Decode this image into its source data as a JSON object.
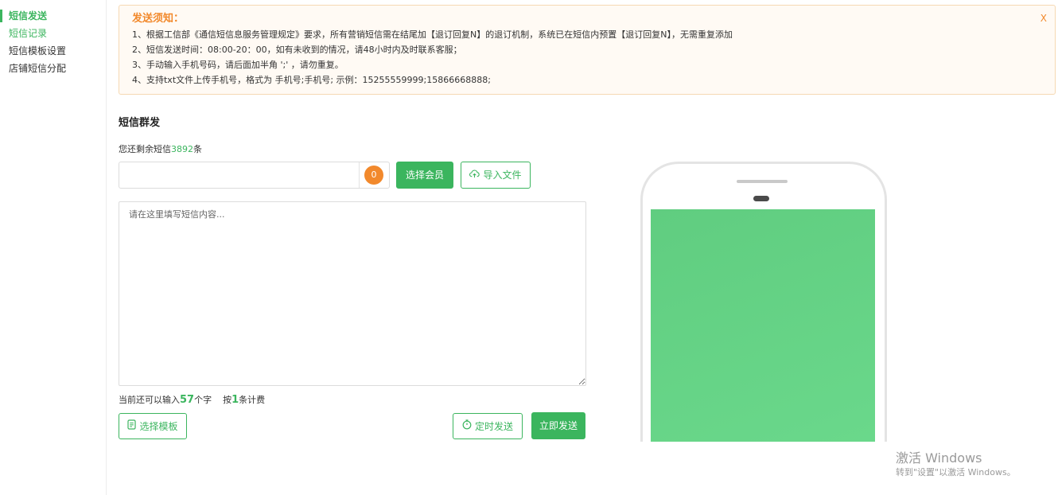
{
  "sidebar": {
    "items": [
      {
        "label": "短信发送"
      },
      {
        "label": "短信记录"
      },
      {
        "label": "短信模板设置"
      },
      {
        "label": "店铺短信分配"
      }
    ]
  },
  "notice": {
    "title": "发送须知：",
    "close": "X",
    "lines": [
      "1、根据工信部《通信短信息服务管理规定》要求，所有营销短信需在结尾加【退订回复N】的退订机制，系统已在短信内预置【退订回复N】，无需重复添加",
      "2、短信发送时间：08:00-20：00，如有未收到的情况，请48小时内及时联系客服；",
      "3、手动输入手机号码，请后面加半角 ';' ，请勿重复。",
      "4、支持txt文件上传手机号，格式为 手机号;手机号; 示例：15255559999;15866668888;"
    ]
  },
  "section_title": "短信群发",
  "remain": {
    "prefix": "您还剩余短信",
    "count": "3892",
    "suffix": "条"
  },
  "phone_input": {
    "value": "",
    "count": "0"
  },
  "buttons": {
    "select_member": "选择会员",
    "import_file": "导入文件",
    "select_template": "选择模板",
    "scheduled_send": "定时发送",
    "send_now": "立即发送"
  },
  "content": {
    "placeholder": "请在这里填写短信内容..."
  },
  "char_info": {
    "prefix": "当前还可以输入",
    "chars": "57",
    "mid": "个字",
    "bill_prefix": "按",
    "bill_count": "1",
    "bill_suffix": "条计费"
  },
  "watermark": {
    "line1": "激活 Windows",
    "line2": "转到\"设置\"以激活 Windows。"
  },
  "colors": {
    "accent": "#3bb55e",
    "warning": "#f2892c",
    "phone_screen": "#64d184"
  },
  "icons": {
    "import": "cloud-upload-icon",
    "template": "document-icon",
    "timer": "stopwatch-icon"
  }
}
